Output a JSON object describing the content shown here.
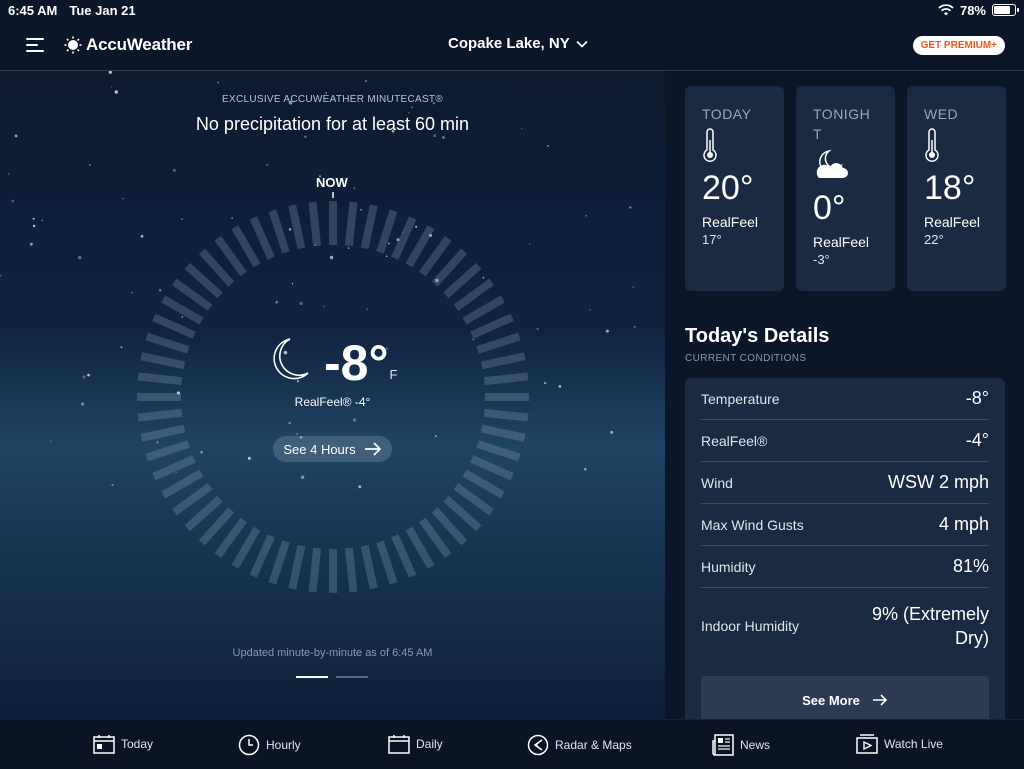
{
  "status_bar": {
    "time": "6:45 AM",
    "date": "Tue Jan 21",
    "battery": "78%",
    "battery_level": 0.78
  },
  "header": {
    "brand": "AccuWeather",
    "location": "Copake Lake, NY",
    "premium_label": "GET PREMIUM+"
  },
  "minutecast": {
    "label": "EXCLUSIVE ACCUWEATHER MINUTECAST®",
    "message": "No precipitation for at least 60 min",
    "now_label": "NOW",
    "updated": "Updated minute-by-minute as of 6:45 AM"
  },
  "current": {
    "temp": "-8°",
    "unit": "F",
    "realfeel": "RealFeel® -4°",
    "see_hours": "See 4 Hours",
    "icon": "moon-icon"
  },
  "forecast": [
    {
      "period": "TODAY",
      "temp": "20°",
      "realfeel_label": "RealFeel",
      "realfeel": "17°",
      "icon": "thermometer-icon"
    },
    {
      "period": "TONIGHT",
      "temp": "0°",
      "realfeel_label": "RealFeel",
      "realfeel": "-3°",
      "icon": "moon-cloud-icon"
    },
    {
      "period": "WED",
      "temp": "18°",
      "realfeel_label": "RealFeel",
      "realfeel": "22°",
      "icon": "thermometer-icon"
    }
  ],
  "details": {
    "title": "Today's Details",
    "subtitle": "CURRENT CONDITIONS",
    "rows": [
      {
        "label": "Temperature",
        "value": "-8°"
      },
      {
        "label": "RealFeel®",
        "value": "-4°"
      },
      {
        "label": "Wind",
        "value": "WSW 2 mph"
      },
      {
        "label": "Max Wind Gusts",
        "value": "4 mph"
      },
      {
        "label": "Humidity",
        "value": "81%"
      },
      {
        "label": "Indoor Humidity",
        "value": "9% (Extremely Dry)"
      }
    ],
    "see_more": "See More"
  },
  "tabs": [
    {
      "label": "Today",
      "icon": "calendar-today-icon"
    },
    {
      "label": "Hourly",
      "icon": "clock-icon"
    },
    {
      "label": "Daily",
      "icon": "calendar-icon"
    },
    {
      "label": "Radar & Maps",
      "icon": "radar-icon"
    },
    {
      "label": "News",
      "icon": "news-icon"
    },
    {
      "label": "Watch Live",
      "icon": "video-icon"
    }
  ],
  "colors": {
    "background": "#0b1628",
    "card": "#1a2a42",
    "premium_text": "#f05514"
  }
}
